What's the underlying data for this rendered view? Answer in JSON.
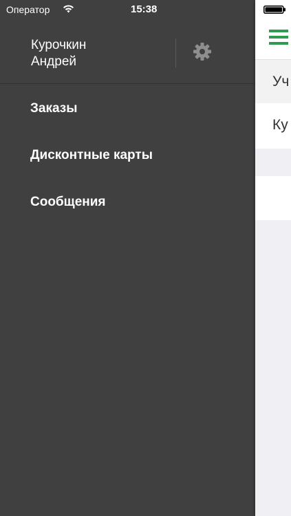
{
  "status_bar": {
    "carrier": "Оператор",
    "time": "15:38"
  },
  "drawer": {
    "user_name": "Курочкин\nАндрей",
    "menu": [
      {
        "label": "Заказы"
      },
      {
        "label": "Дисконтные карты"
      },
      {
        "label": "Сообщения"
      }
    ]
  },
  "content": {
    "section_header": "Уч",
    "row_text": "Ку"
  },
  "colors": {
    "drawer_bg": "#404040",
    "accent_green": "#2e9b4e",
    "gear_gray": "#8e8e8e"
  },
  "icons": [
    "wifi-icon",
    "gear-icon",
    "battery-icon",
    "hamburger-icon"
  ]
}
